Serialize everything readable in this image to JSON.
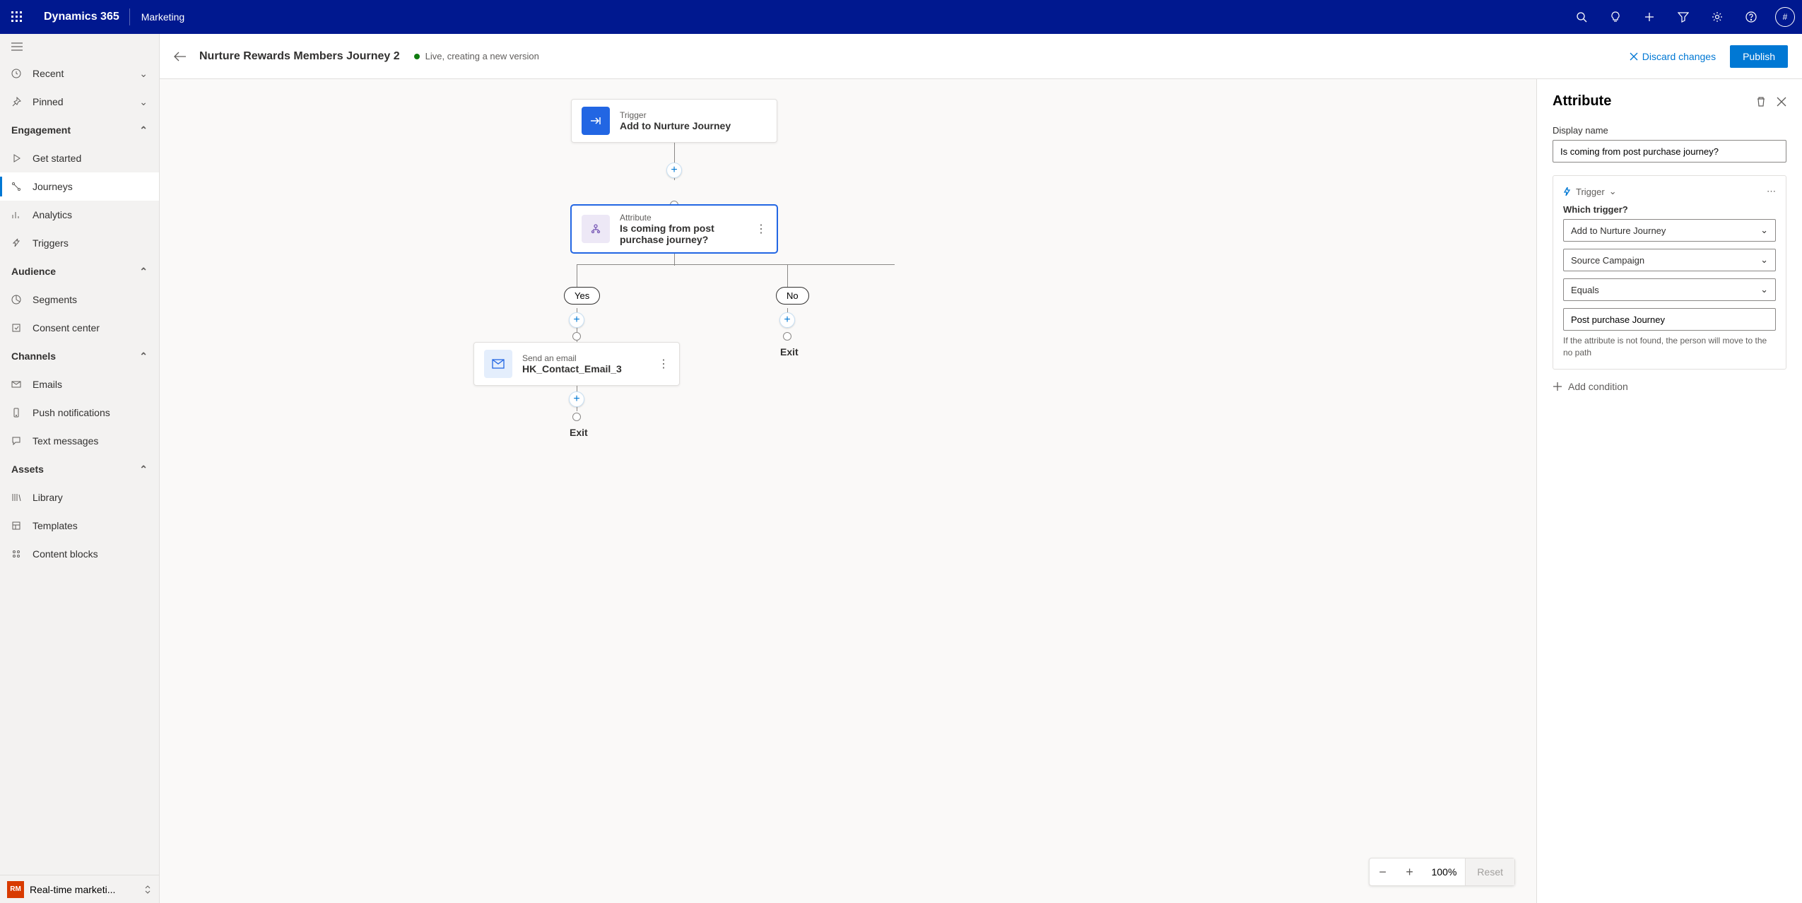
{
  "top": {
    "brand": "Dynamics 365",
    "app": "Marketing",
    "avatar": "#"
  },
  "sidebar": {
    "recent": "Recent",
    "pinned": "Pinned",
    "groups": {
      "engagement": "Engagement",
      "audience": "Audience",
      "channels": "Channels",
      "assets": "Assets"
    },
    "items": {
      "getstarted": "Get started",
      "journeys": "Journeys",
      "analytics": "Analytics",
      "triggers": "Triggers",
      "segments": "Segments",
      "consent": "Consent center",
      "emails": "Emails",
      "push": "Push notifications",
      "text": "Text messages",
      "library": "Library",
      "templates": "Templates",
      "blocks": "Content blocks"
    },
    "area": {
      "badge": "RM",
      "label": "Real-time marketi..."
    }
  },
  "header": {
    "title": "Nurture Rewards Members Journey 2",
    "status": "Live, creating a new version",
    "discard": "Discard changes",
    "publish": "Publish"
  },
  "flow": {
    "trigger_label": "Trigger",
    "trigger_title": "Add to Nurture Journey",
    "attr_label": "Attribute",
    "attr_title": "Is coming from post purchase journey?",
    "yes": "Yes",
    "no": "No",
    "email_label": "Send an email",
    "email_title": "HK_Contact_Email_3",
    "exit": "Exit"
  },
  "zoom": {
    "value": "100%",
    "reset": "Reset"
  },
  "panel": {
    "heading": "Attribute",
    "display_name_label": "Display name",
    "display_name_value": "Is coming from post purchase journey?",
    "pill": "Trigger",
    "which": "Which trigger?",
    "sel_trigger": "Add to Nurture Journey",
    "sel_field": "Source Campaign",
    "sel_op": "Equals",
    "sel_value": "Post purchase Journey",
    "note": "If the attribute is not found, the person will move to the no path",
    "addcond": "Add condition"
  }
}
